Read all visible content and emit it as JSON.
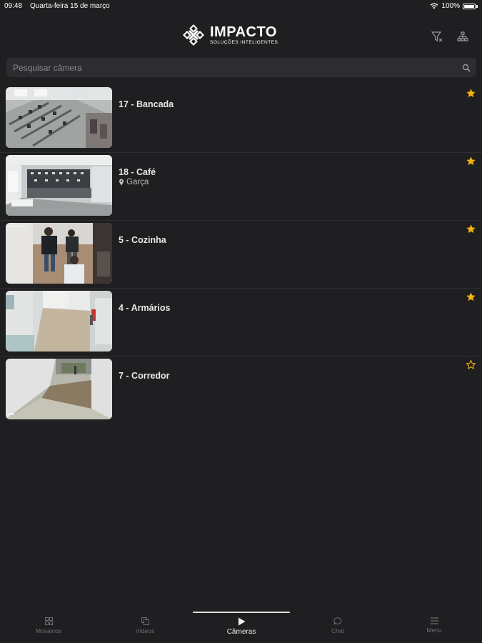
{
  "status_bar": {
    "time": "09:48",
    "date": "Quarta-feira 15 de março",
    "battery": "100%"
  },
  "header": {
    "brand_name": "IMPACTO",
    "brand_tagline": "SOLUÇÕES INTELIGENTES"
  },
  "search": {
    "placeholder": "Pesquisar câmera"
  },
  "colors": {
    "background": "#1f1f21",
    "star": "#f2b20f",
    "search_bg": "#2d2d30"
  },
  "cameras": [
    {
      "name": "17 - Bancada",
      "location": "",
      "favorite": true
    },
    {
      "name": "18 - Café",
      "location": "Garça",
      "favorite": true
    },
    {
      "name": "5 - Cozinha",
      "location": "",
      "favorite": true
    },
    {
      "name": "4 - Armários",
      "location": "",
      "favorite": true
    },
    {
      "name": "7 - Corredor",
      "location": "",
      "favorite": false
    }
  ],
  "tabs": [
    {
      "label": "Mosaicos",
      "icon": "grid-icon"
    },
    {
      "label": "Vídeos",
      "icon": "copy-icon"
    },
    {
      "label": "Câmeras",
      "icon": "play-icon",
      "active": true
    },
    {
      "label": "Chat",
      "icon": "chat-icon"
    },
    {
      "label": "Menu",
      "icon": "menu-icon"
    }
  ]
}
